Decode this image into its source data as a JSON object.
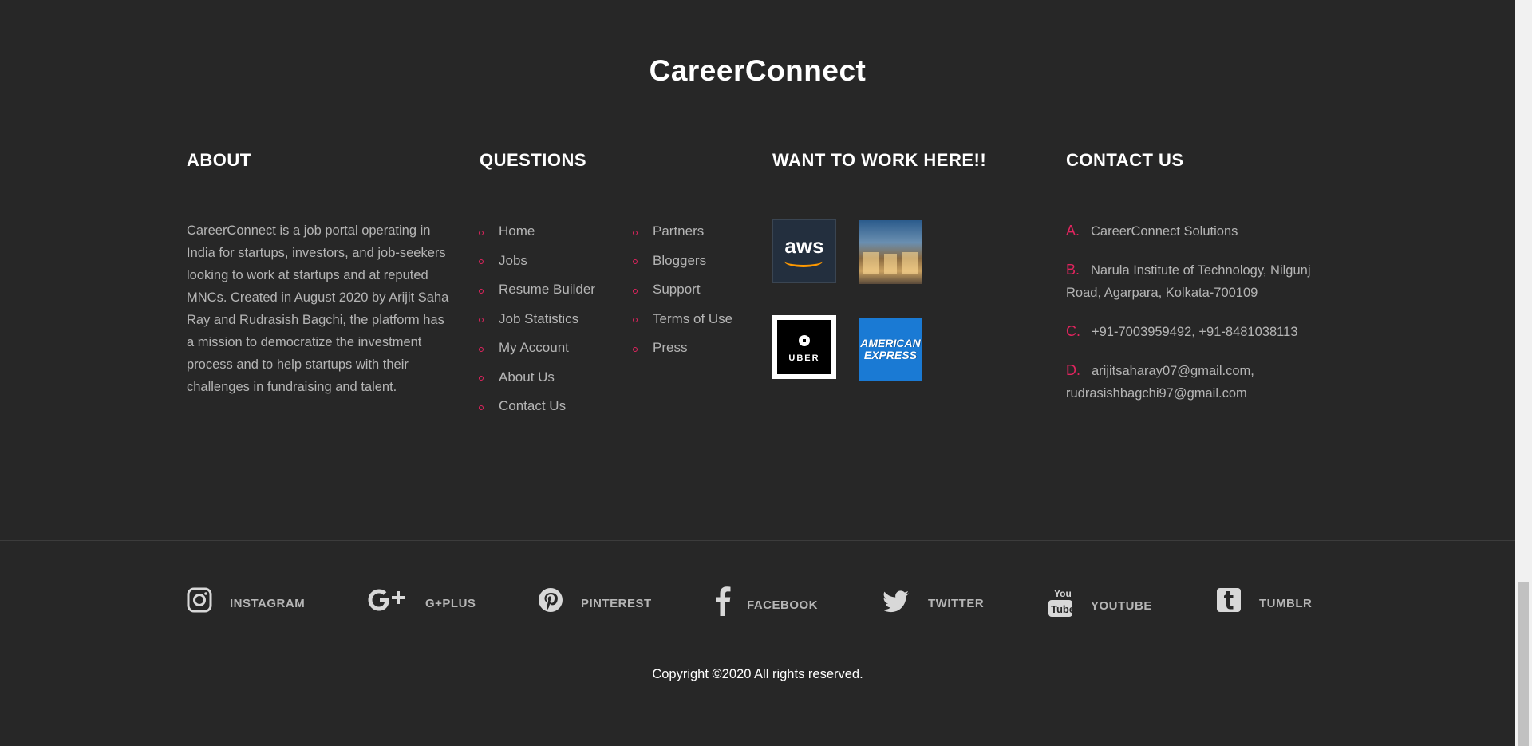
{
  "brand": "CareerConnect",
  "about": {
    "title": "ABOUT",
    "text": "CareerConnect is a job portal operating in India for startups, investors, and job-seekers looking to work at startups and at reputed MNCs. Created in August 2020 by Arijit Saha Ray and Rudrasish Bagchi, the platform has a mission to democratize the investment process and to help startups with their challenges in fundraising and talent."
  },
  "questions": {
    "title": "QUESTIONS",
    "col1": [
      "Home",
      "Jobs",
      "Resume Builder",
      "Job Statistics",
      "My Account",
      "About Us",
      "Contact Us"
    ],
    "col2": [
      "Partners",
      "Bloggers",
      "Support",
      "Terms of Use",
      "Press"
    ]
  },
  "work": {
    "title": "WANT TO WORK HERE!!",
    "logos": {
      "aws": "aws",
      "uber": "UBER",
      "amex_line1": "AMERICAN",
      "amex_line2": "EXPRESS"
    }
  },
  "contact": {
    "title": "CONTACT US",
    "items": [
      {
        "letter": "A.",
        "text": "CareerConnect Solutions"
      },
      {
        "letter": "B.",
        "text": "Narula Institute of Technology, Nilgunj Road, Agarpara, Kolkata-700109"
      },
      {
        "letter": "C.",
        "text": "+91-7003959492, +91-8481038113"
      },
      {
        "letter": "D.",
        "text": "arijitsaharay07@gmail.com, rudrasishbagchi97@gmail.com"
      }
    ]
  },
  "social": [
    {
      "label": "INSTAGRAM",
      "icon": "instagram-icon"
    },
    {
      "label": "G+PLUS",
      "icon": "google-plus-icon"
    },
    {
      "label": "PINTEREST",
      "icon": "pinterest-icon"
    },
    {
      "label": "FACEBOOK",
      "icon": "facebook-icon"
    },
    {
      "label": "TWITTER",
      "icon": "twitter-icon"
    },
    {
      "label": "YOUTUBE",
      "icon": "youtube-icon"
    },
    {
      "label": "TUMBLR",
      "icon": "tumblr-icon"
    }
  ],
  "copyright": "Copyright ©2020 All rights reserved.",
  "colors": {
    "background": "#272727",
    "accent": "#e0245e",
    "text": "#b5b5b5",
    "heading": "#ffffff"
  }
}
